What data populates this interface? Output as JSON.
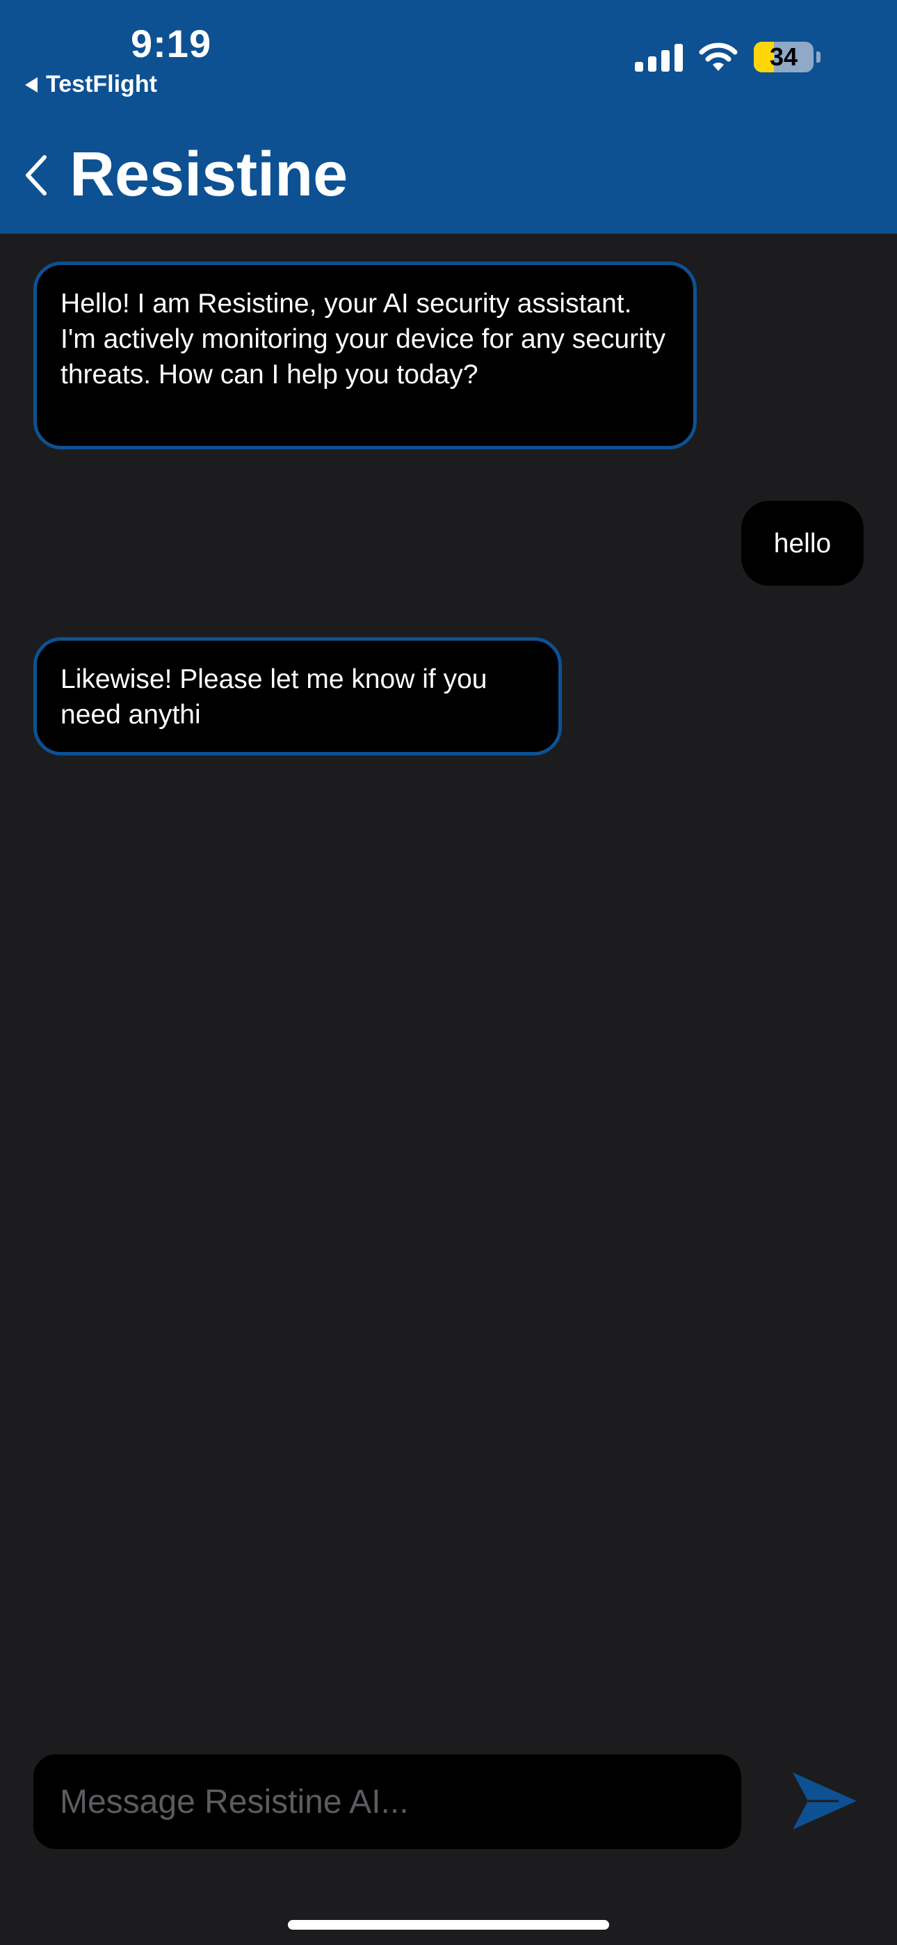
{
  "status_bar": {
    "time": "9:19",
    "back_app_label": "TestFlight",
    "battery_level": "34",
    "battery_fraction": 0.34,
    "signal_icon": "cellular-signal-icon",
    "wifi_icon": "wifi-icon"
  },
  "nav": {
    "title": "Resistine",
    "back_icon": "chevron-left-icon"
  },
  "messages": [
    {
      "sender": "bot",
      "text": "Hello! I am Resistine, your AI security assistant. I'm actively monitoring your device for any security threats. How can I help you today?"
    },
    {
      "sender": "user",
      "text": "hello"
    },
    {
      "sender": "bot",
      "text": "Likewise! Please let me know if you need anythi"
    }
  ],
  "composer": {
    "placeholder": "Message Resistine AI...",
    "value": "",
    "send_icon": "paper-plane-send-icon"
  },
  "colors": {
    "accent": "#0d5193",
    "background": "#1c1c1e",
    "bubble": "#000000",
    "battery_low": "#ffd60a"
  }
}
